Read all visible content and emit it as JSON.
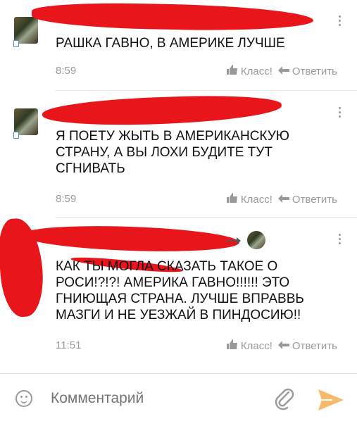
{
  "comments": [
    {
      "text": "РАШКА ГАВНО,  В АМЕРИКЕ ЛУЧШЕ",
      "time": "8:59",
      "like": "Класс!",
      "reply": "Ответить"
    },
    {
      "text": "Я ПОЕТУ ЖЫТЬ В АМЕРИКАНСКУЮ СТРАНУ,  А ВЫ ЛОХИ БУДИТЕ ТУТ СГНИВАТЬ",
      "time": "8:59",
      "like": "Класс!",
      "reply": "Ответить"
    },
    {
      "text": "КАК ТЫ МОГЛА СКАЗАТЬ ТАКОЕ О РОСИ!?!?! АМЕРИКА ГАВНО!!!!!! ЭТО ГНИЮЩАЯ СТРАНА. ЛУЧШЕ ВПРАВВЬ МАЗГИ И НЕ УЕЗЖАЙ В ПИНДОСИЮ!!",
      "time": "11:51",
      "like": "Класс!",
      "reply": "Ответить"
    }
  ],
  "composer": {
    "placeholder": "Комментарий"
  },
  "colors": {
    "scribble": "#e8161b",
    "send": "#f7b96a",
    "muted": "#9a9a9a"
  }
}
